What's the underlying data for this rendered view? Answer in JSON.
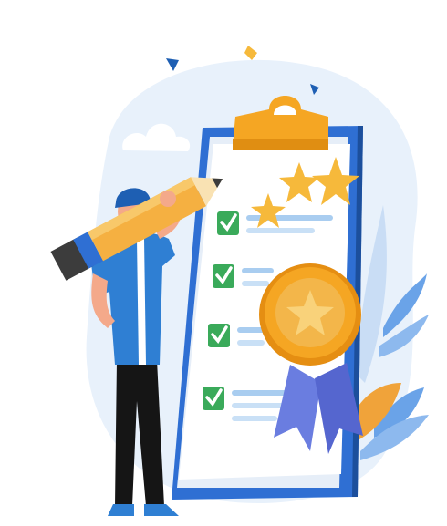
{
  "illustration": {
    "subject": "checklist-achievement",
    "palette": {
      "blob": "#e8f1fb",
      "clipboard_board": "#2f6fd3",
      "paper": "#ffffff",
      "paper_shadow": "#e6eef8",
      "clip": "#f5a623",
      "checkbox": "#3aaa5a",
      "check_mark": "#ffffff",
      "line": "#a9cdf0",
      "medal": "#f5a623",
      "medal_inner": "#f3b64a",
      "ribbon": "#6a7de0",
      "star": "#f6b93b",
      "shirt": "#2f7fd3",
      "pants": "#151515",
      "skin": "#f4a98a",
      "hat": "#1e5fb3",
      "pencil_body": "#f5b041",
      "pencil_band": "#2f6fd3",
      "pencil_tip": "#f9e2b3",
      "eraser": "#3c3c3c",
      "leaf": "#6aa3e8",
      "leaf_orange": "#f0a33a"
    },
    "checklist_items": 4,
    "stars": 3
  }
}
